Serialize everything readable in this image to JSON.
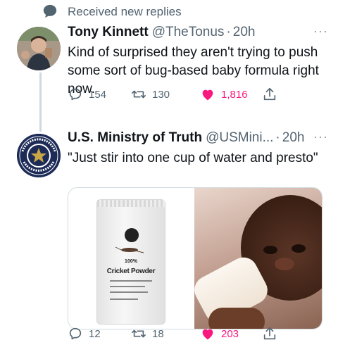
{
  "header": {
    "label": "Received new replies",
    "icon": "speech-bubble-icon"
  },
  "tweets": [
    {
      "name": "Tony Kinnett",
      "handle": "@TheTonus",
      "separator": "·",
      "time": "20h",
      "text": "Kind of surprised they aren't trying to push some sort of bug-based baby formula right now.",
      "more": "···",
      "stats": {
        "replies": "154",
        "retweets": "130",
        "likes": "1,816"
      },
      "liked": true
    },
    {
      "name": "U.S. Ministry of Truth",
      "handle": "@USMini...",
      "separator": "·",
      "time": "20h",
      "text": "\"Just stir into one cup of water and presto\"",
      "more": "···",
      "avatar_text": "U.S. DISINFORMATION GOVERNANCE BOARD",
      "media": {
        "product_percent": "100%",
        "product_name": "Cricket Powder"
      },
      "stats": {
        "replies": "12",
        "retweets": "18",
        "likes": "203"
      },
      "liked": true
    }
  ],
  "colors": {
    "like": "#f91880",
    "secondary_text": "#536471",
    "thread_line": "#cfd9de"
  }
}
